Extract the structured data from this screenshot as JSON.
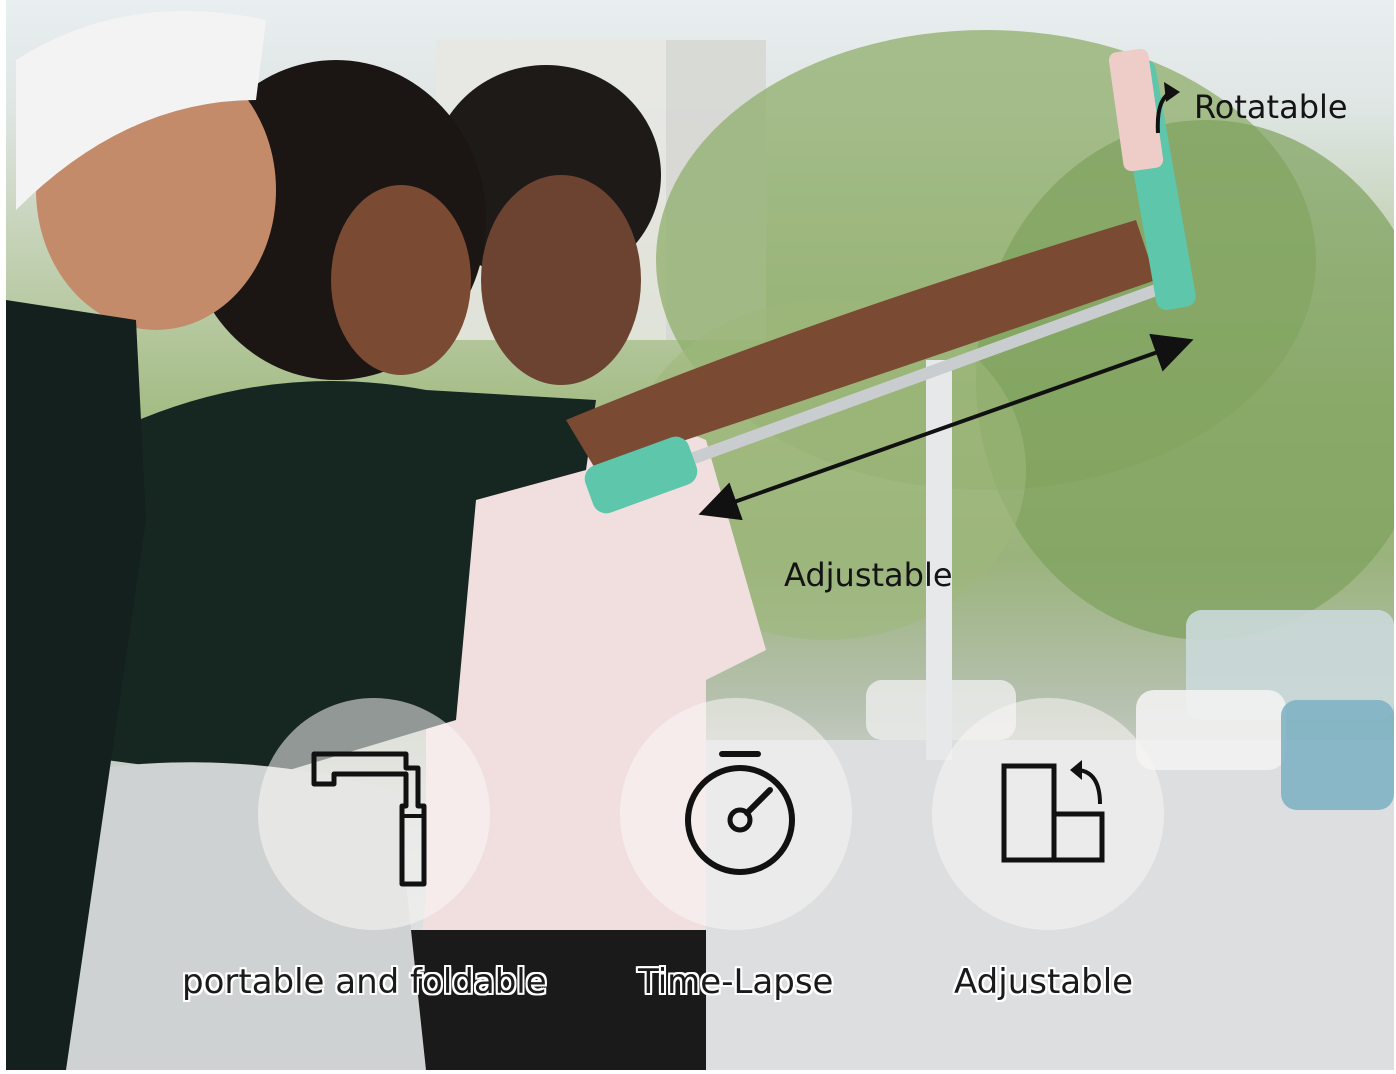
{
  "annotations": {
    "rotatable": "Rotatable",
    "adjustable_length": "Adjustable"
  },
  "features": [
    {
      "icon": "foldable-stick-icon",
      "caption": "portable and foldable"
    },
    {
      "icon": "stopwatch-icon",
      "caption": "Time-Lapse"
    },
    {
      "icon": "rotate-orientation-icon",
      "caption": "Adjustable"
    }
  ],
  "colors": {
    "accent_teal": "#5ec6ab",
    "text_dark": "#141414"
  }
}
